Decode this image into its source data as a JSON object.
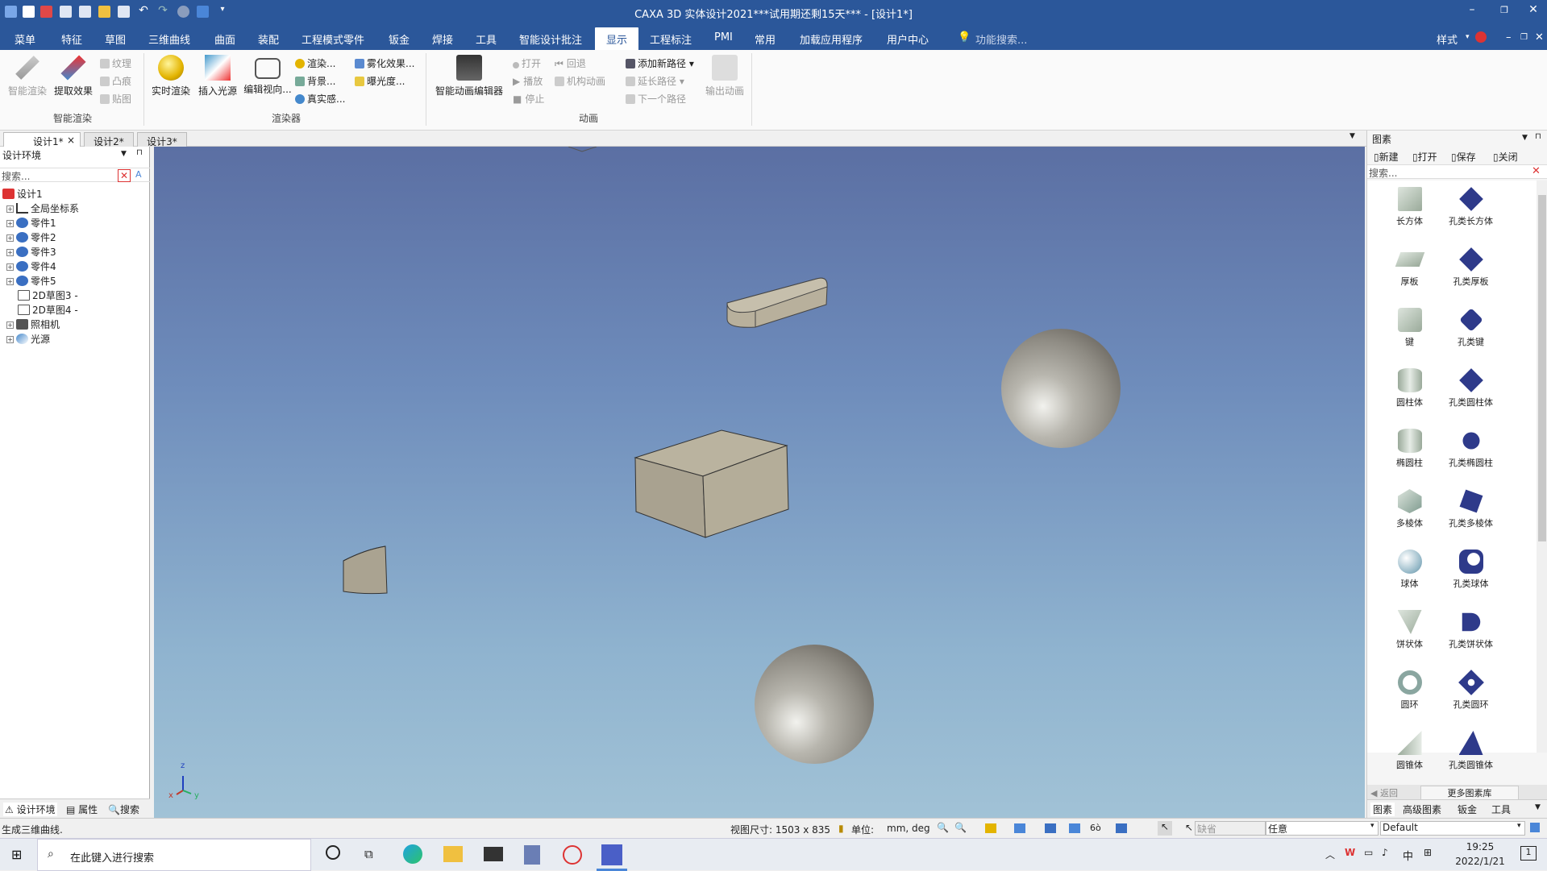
{
  "window": {
    "title": "CAXA 3D 实体设计2021***试用期还剩15天*** - [设计1*]"
  },
  "menu": {
    "items": [
      "菜单",
      "特征",
      "草图",
      "三维曲线",
      "曲面",
      "装配",
      "工程模式零件",
      "钣金",
      "焊接",
      "工具",
      "智能设计批注",
      "显示",
      "工程标注",
      "PMI",
      "常用",
      "加载应用程序",
      "用户中心"
    ],
    "active": "显示",
    "search_placeholder": "功能搜索...",
    "style_label": "样式"
  },
  "ribbon": {
    "smart_render": {
      "btn1": "智能渲染",
      "btn2": "提取效果",
      "texture": "纹理",
      "bump": "凸痕",
      "decal": "贴图",
      "group": "智能渲染"
    },
    "renderer": {
      "realtime": "实时渲染",
      "insert_light": "插入光源",
      "edit_view": "编辑视向...",
      "render": "渲染...",
      "background": "背景...",
      "realism": "真实感...",
      "fog": "雾化效果...",
      "exposure": "曝光度...",
      "group": "渲染器"
    },
    "animation": {
      "editor": "智能动画编辑器",
      "open": "打开",
      "play": "播放",
      "stop": "停止",
      "rewind": "回退",
      "mech_anim": "机构动画",
      "add_path": "添加新路径",
      "extend_path": "延长路径",
      "next_path": "下一个路径",
      "output": "输出动画",
      "group": "动画"
    }
  },
  "doc_tabs": [
    "设计1*",
    "设计2*",
    "设计3*"
  ],
  "left_panel": {
    "title": "设计环境",
    "search_placeholder": "搜索...",
    "tree": [
      "设计1",
      "全局坐标系",
      "零件1",
      "零件2",
      "零件3",
      "零件4",
      "零件5",
      "2D草图3 -",
      "2D草图4 -",
      "照相机",
      "光源"
    ],
    "bottom_tabs": [
      "设计环境",
      "属性",
      "搜索"
    ]
  },
  "viewport": {
    "axis_labels": [
      "z",
      "x",
      "y"
    ]
  },
  "right_panel": {
    "title": "图素",
    "toolbar": [
      "新建",
      "打开",
      "保存",
      "关闭"
    ],
    "search_placeholder": "搜索...",
    "items": [
      [
        "长方体",
        "孔类长方体"
      ],
      [
        "厚板",
        "孔类厚板"
      ],
      [
        "键",
        "孔类键"
      ],
      [
        "圆柱体",
        "孔类圆柱体"
      ],
      [
        "椭圆柱",
        "孔类椭圆柱"
      ],
      [
        "多棱体",
        "孔类多棱体"
      ],
      [
        "球体",
        "孔类球体"
      ],
      [
        "饼状体",
        "孔类饼状体"
      ],
      [
        "圆环",
        "孔类圆环"
      ],
      [
        "圆锥体",
        "孔类圆锥体"
      ]
    ],
    "back": "返回",
    "more": "更多图素库",
    "bottom_tabs": [
      "图素",
      "高级图素",
      "钣金",
      "工具"
    ]
  },
  "status": {
    "message": "生成三维曲线.",
    "view_size": "视图尺寸: 1503 x  835",
    "unit_label": "单位:",
    "unit_value": "mm, deg",
    "default_field": "缺省",
    "any_field": "任意",
    "default_select": "Default"
  },
  "taskbar": {
    "search_placeholder": "在此键入进行搜索",
    "time": "19:25",
    "date": "2022/1/21",
    "ime": "中",
    "notif_count": "1"
  }
}
